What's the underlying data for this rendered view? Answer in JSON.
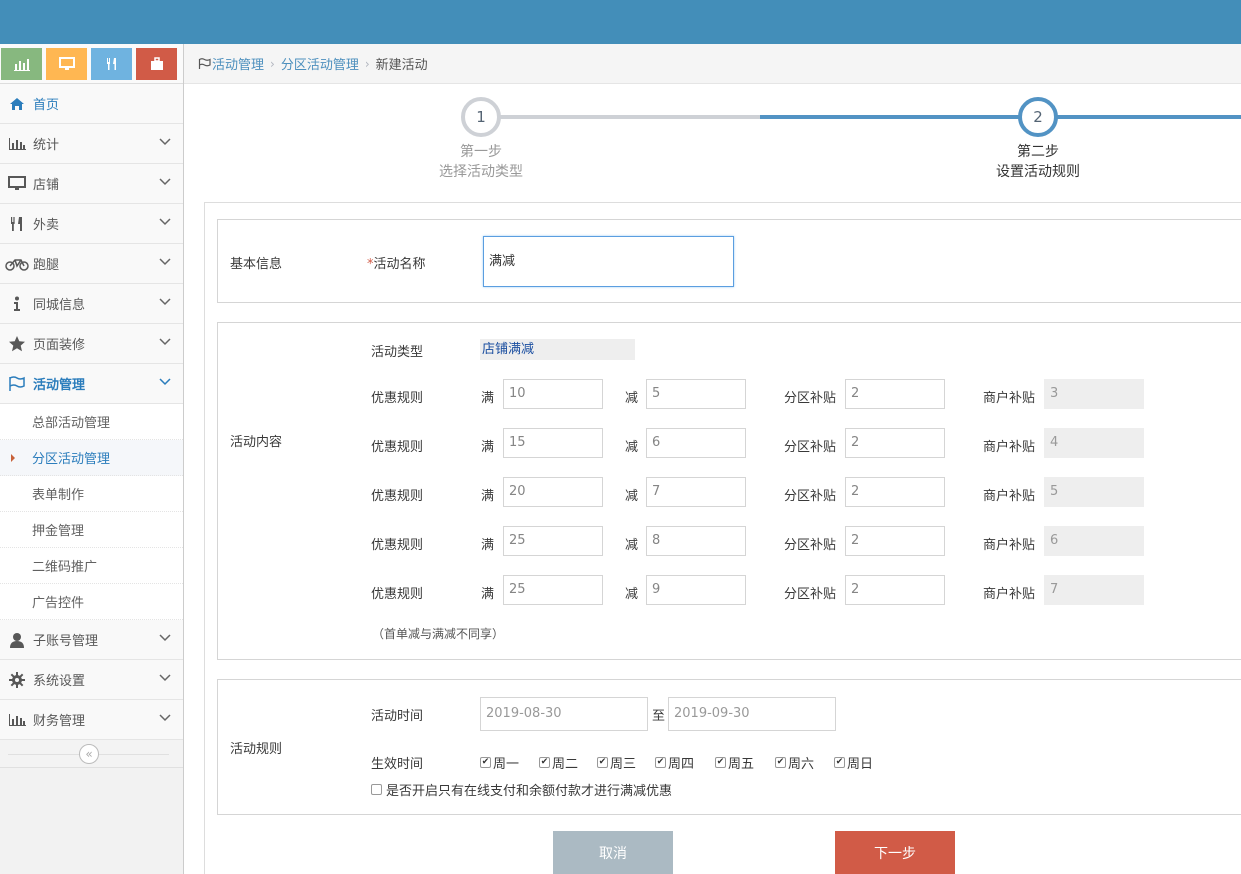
{
  "colors": {
    "topbar": "#438eb9",
    "accent": "#2b7dbc",
    "danger": "#d15b47",
    "cancel": "#abbac3"
  },
  "shortcuts": [
    {
      "icon": "bar-chart-icon",
      "color": "#87b87f"
    },
    {
      "icon": "monitor-icon",
      "color": "#ffb752"
    },
    {
      "icon": "fork-knife-icon",
      "color": "#6fb3e0"
    },
    {
      "icon": "briefcase-icon",
      "color": "#d15b47"
    }
  ],
  "sidebar": {
    "home": "首页",
    "stats": "统计",
    "shop": "店铺",
    "takeout": "外卖",
    "errand": "跑腿",
    "cityinfo": "同城信息",
    "decoration": "页面装修",
    "activity": "活动管理",
    "activity_sub": [
      "总部活动管理",
      "分区活动管理",
      "表单制作",
      "押金管理",
      "二维码推广",
      "广告控件"
    ],
    "subaccount": "子账号管理",
    "settings": "系统设置",
    "finance": "财务管理",
    "collapse": "«"
  },
  "breadcrumb": {
    "l1": "活动管理",
    "l2": "分区活动管理",
    "current": "新建活动",
    "sep": "›"
  },
  "steps": [
    {
      "num": "1",
      "title": "第一步",
      "subtitle": "选择活动类型"
    },
    {
      "num": "2",
      "title": "第二步",
      "subtitle": "设置活动规则"
    }
  ],
  "basic": {
    "section": "基本信息",
    "required_mark": "*",
    "name_label": "活动名称",
    "name_value": "满减"
  },
  "content": {
    "section": "活动内容",
    "type_label": "活动类型",
    "type_value": "店铺满减",
    "rule_label": "优惠规则",
    "full_label": "满",
    "minus_label": "减",
    "district_label": "分区补贴",
    "merchant_label": "商户补贴",
    "rules": [
      {
        "full": "10",
        "minus": "5",
        "district": "2",
        "merchant": "3"
      },
      {
        "full": "15",
        "minus": "6",
        "district": "2",
        "merchant": "4"
      },
      {
        "full": "20",
        "minus": "7",
        "district": "2",
        "merchant": "5"
      },
      {
        "full": "25",
        "minus": "8",
        "district": "2",
        "merchant": "6"
      },
      {
        "full": "25",
        "minus": "9",
        "district": "2",
        "merchant": "7"
      }
    ],
    "note": "（首单减与满减不同享）"
  },
  "rules": {
    "section": "活动规则",
    "time_label": "活动时间",
    "start": "2019-08-30",
    "to": "至",
    "end": "2019-09-30",
    "effective_label": "生效时间",
    "days": [
      "周一",
      "周二",
      "周三",
      "周四",
      "周五",
      "周六",
      "周日"
    ],
    "online_only": "是否开启只有在线支付和余额付款才进行满减优惠"
  },
  "buttons": {
    "cancel": "取消",
    "next": "下一步"
  }
}
